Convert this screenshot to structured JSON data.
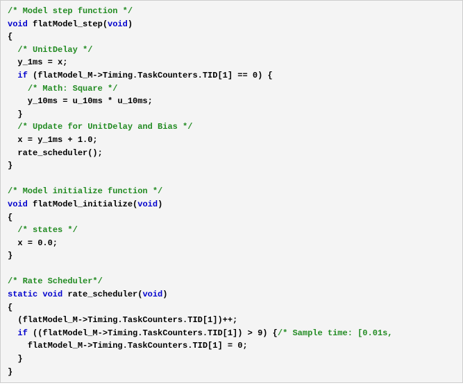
{
  "code": {
    "lines": [
      {
        "seg": [
          {
            "c": "comment",
            "t": "/* Model step function */"
          }
        ]
      },
      {
        "seg": [
          {
            "c": "keyword",
            "t": "void"
          },
          {
            "c": "plain",
            "t": " flatModel_step("
          },
          {
            "c": "keyword",
            "t": "void"
          },
          {
            "c": "plain",
            "t": ")"
          }
        ]
      },
      {
        "seg": [
          {
            "c": "plain",
            "t": "{"
          }
        ]
      },
      {
        "seg": [
          {
            "c": "plain",
            "t": "  "
          },
          {
            "c": "comment",
            "t": "/* UnitDelay */"
          }
        ]
      },
      {
        "seg": [
          {
            "c": "plain",
            "t": "  y_1ms = x;"
          }
        ]
      },
      {
        "seg": [
          {
            "c": "plain",
            "t": "  "
          },
          {
            "c": "keyword",
            "t": "if"
          },
          {
            "c": "plain",
            "t": " (flatModel_M->Timing.TaskCounters.TID[1] == 0) {"
          }
        ]
      },
      {
        "seg": [
          {
            "c": "plain",
            "t": "    "
          },
          {
            "c": "comment",
            "t": "/* Math: Square */"
          }
        ]
      },
      {
        "seg": [
          {
            "c": "plain",
            "t": "    y_10ms = u_10ms * u_10ms;"
          }
        ]
      },
      {
        "seg": [
          {
            "c": "plain",
            "t": "  }"
          }
        ]
      },
      {
        "seg": [
          {
            "c": "plain",
            "t": "  "
          },
          {
            "c": "comment",
            "t": "/* Update for UnitDelay and Bias */"
          }
        ]
      },
      {
        "seg": [
          {
            "c": "plain",
            "t": "  x = y_1ms + 1.0;"
          }
        ]
      },
      {
        "seg": [
          {
            "c": "plain",
            "t": "  rate_scheduler();"
          }
        ]
      },
      {
        "seg": [
          {
            "c": "plain",
            "t": "}"
          }
        ]
      },
      {
        "seg": [
          {
            "c": "plain",
            "t": " "
          }
        ]
      },
      {
        "seg": [
          {
            "c": "comment",
            "t": "/* Model initialize function */"
          }
        ]
      },
      {
        "seg": [
          {
            "c": "keyword",
            "t": "void"
          },
          {
            "c": "plain",
            "t": " flatModel_initialize("
          },
          {
            "c": "keyword",
            "t": "void"
          },
          {
            "c": "plain",
            "t": ")"
          }
        ]
      },
      {
        "seg": [
          {
            "c": "plain",
            "t": "{"
          }
        ]
      },
      {
        "seg": [
          {
            "c": "plain",
            "t": "  "
          },
          {
            "c": "comment",
            "t": "/* states */"
          }
        ]
      },
      {
        "seg": [
          {
            "c": "plain",
            "t": "  x = 0.0;"
          }
        ]
      },
      {
        "seg": [
          {
            "c": "plain",
            "t": "}"
          }
        ]
      },
      {
        "seg": [
          {
            "c": "plain",
            "t": " "
          }
        ]
      },
      {
        "seg": [
          {
            "c": "comment",
            "t": "/* Rate Scheduler*/"
          }
        ]
      },
      {
        "seg": [
          {
            "c": "keyword",
            "t": "static void"
          },
          {
            "c": "plain",
            "t": " rate_scheduler("
          },
          {
            "c": "keyword",
            "t": "void"
          },
          {
            "c": "plain",
            "t": ")"
          }
        ]
      },
      {
        "seg": [
          {
            "c": "plain",
            "t": "{"
          }
        ]
      },
      {
        "seg": [
          {
            "c": "plain",
            "t": "  (flatModel_M->Timing.TaskCounters.TID[1])++;"
          }
        ]
      },
      {
        "seg": [
          {
            "c": "plain",
            "t": "  "
          },
          {
            "c": "keyword",
            "t": "if"
          },
          {
            "c": "plain",
            "t": " ((flatModel_M->Timing.TaskCounters.TID[1]) > 9) {"
          },
          {
            "c": "comment",
            "t": "/* Sample time: [0.01s,"
          }
        ]
      },
      {
        "seg": [
          {
            "c": "plain",
            "t": "    flatModel_M->Timing.TaskCounters.TID[1] = 0;"
          }
        ]
      },
      {
        "seg": [
          {
            "c": "plain",
            "t": "  }"
          }
        ]
      },
      {
        "seg": [
          {
            "c": "plain",
            "t": "}"
          }
        ]
      }
    ]
  }
}
